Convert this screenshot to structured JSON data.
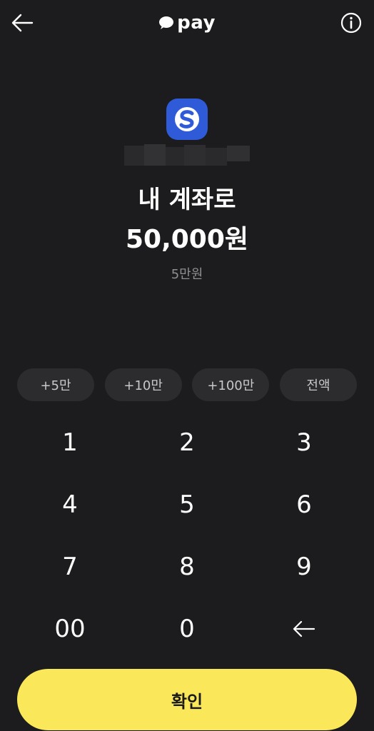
{
  "header": {
    "brand": "pay",
    "back_icon": "arrow-left-icon",
    "info_icon": "info-circle-icon",
    "brand_icon": "speech-bubble-icon"
  },
  "account": {
    "bank_logo_icon": "shinhan-bank-logo-icon",
    "bank_color": "#2f5bd9"
  },
  "transfer": {
    "target": "내 계좌로",
    "amount": "50,000원",
    "amount_hint": "5만원"
  },
  "quick_amounts": [
    "+5만",
    "+10만",
    "+100만",
    "전액"
  ],
  "keypad": {
    "keys": [
      "1",
      "2",
      "3",
      "4",
      "5",
      "6",
      "7",
      "8",
      "9",
      "00",
      "0"
    ],
    "backspace_icon": "backspace-arrow-icon"
  },
  "confirm_label": "확인",
  "colors": {
    "background": "#1c1c1e",
    "chip": "#2c2c2e",
    "accent": "#fbe85a"
  }
}
